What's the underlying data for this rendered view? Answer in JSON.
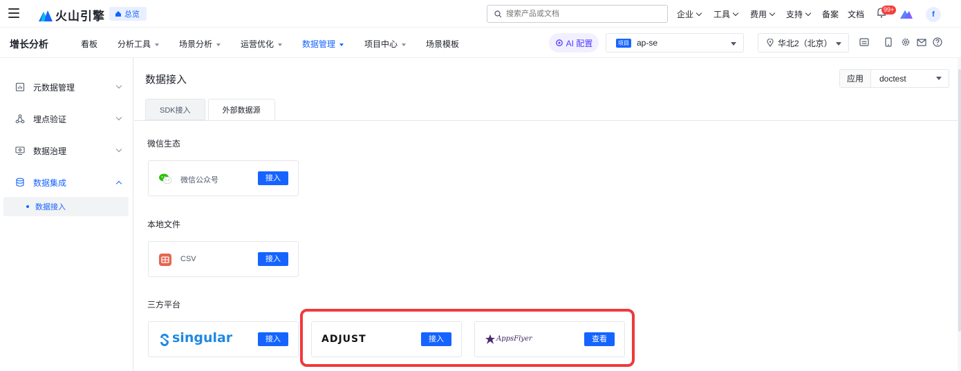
{
  "topbar": {
    "logo_text": "火山引擎",
    "overview_label": "总览",
    "search_placeholder": "搜索产品或文档",
    "nav": [
      {
        "label": "企业",
        "has_caret": true
      },
      {
        "label": "工具",
        "has_caret": true
      },
      {
        "label": "费用",
        "has_caret": true
      },
      {
        "label": "支持",
        "has_caret": true
      },
      {
        "label": "备案",
        "has_caret": false
      },
      {
        "label": "文档",
        "has_caret": false
      }
    ],
    "notification_badge": "99+",
    "avatar_letter": "f"
  },
  "secbar": {
    "title": "增长分析",
    "items": [
      {
        "label": "看板",
        "dropdown": false,
        "active": false
      },
      {
        "label": "分析工具",
        "dropdown": true,
        "active": false
      },
      {
        "label": "场景分析",
        "dropdown": true,
        "active": false
      },
      {
        "label": "运营优化",
        "dropdown": true,
        "active": false
      },
      {
        "label": "数据管理",
        "dropdown": true,
        "active": true
      },
      {
        "label": "项目中心",
        "dropdown": true,
        "active": false
      },
      {
        "label": "场景模板",
        "dropdown": false,
        "active": false
      }
    ],
    "ai_label": "AI 配置",
    "project_tag": "项目",
    "project_value": "ap-se",
    "region_value": "华北2（北京）"
  },
  "sidebar": {
    "items": [
      {
        "label": "元数据管理",
        "icon": "chart-doc-icon",
        "expanded": false
      },
      {
        "label": "埋点验证",
        "icon": "nodes-icon",
        "expanded": false
      },
      {
        "label": "数据治理",
        "icon": "monitor-gear-icon",
        "expanded": false
      },
      {
        "label": "数据集成",
        "icon": "database-icon",
        "expanded": true
      }
    ],
    "sub_item": "数据接入"
  },
  "main": {
    "page_title": "数据接入",
    "app_label": "应用",
    "app_value": "doctest",
    "tabs": [
      {
        "label": "SDK接入",
        "active": false
      },
      {
        "label": "外部数据源",
        "active": true
      }
    ],
    "sections": [
      {
        "title": "微信生态",
        "cards": [
          {
            "name": "微信公众号",
            "icon": "wechat-icon",
            "button": "接入"
          }
        ]
      },
      {
        "title": "本地文件",
        "cards": [
          {
            "name": "CSV",
            "icon": "csv-file-icon",
            "button": "接入"
          }
        ]
      },
      {
        "title": "三方平台",
        "cards": [
          {
            "name": "singular",
            "icon": "singular-logo",
            "button": "接入"
          },
          {
            "name": "ADJUST",
            "icon": "adjust-logo",
            "button": "接入"
          },
          {
            "name": "AppsFlyer",
            "icon": "appsflyer-logo",
            "button": "查看"
          }
        ]
      }
    ]
  },
  "colors": {
    "primary": "#1664ff",
    "highlight": "#f0393a",
    "wechat": "#2dc100",
    "csv": "#e5664f"
  }
}
